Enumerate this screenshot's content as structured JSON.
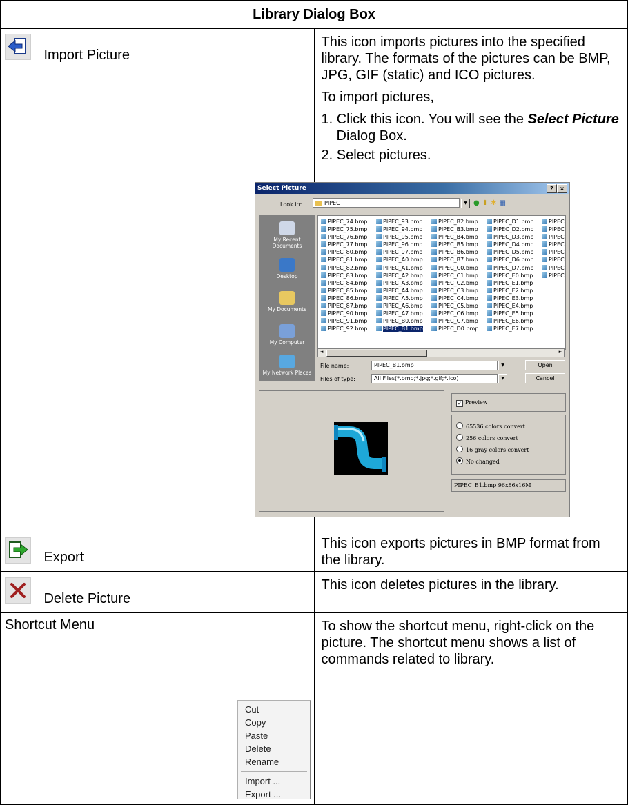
{
  "table": {
    "header": "Library Dialog Box",
    "rows": [
      {
        "label": "Import Picture",
        "icon": "import-icon",
        "desc1": "This icon imports pictures into the specified library. The formats of the pictures can be BMP, JPG, GIF (static) and ICO pictures.",
        "desc2": "To import pictures,",
        "step1_prefix": "1. Click this icon. You will see the ",
        "step1_em": "Select Picture",
        "step1_suffix": " Dialog Box.",
        "step2": "2. Select pictures."
      },
      {
        "label": "Export",
        "icon": "export-icon",
        "desc": "This icon exports pictures in BMP format from the library."
      },
      {
        "label": "Delete Picture",
        "icon": "delete-icon",
        "desc": "This icon deletes pictures in the library."
      },
      {
        "label": "Shortcut Menu",
        "desc": "To show the shortcut menu, right-click on the picture. The shortcut menu shows a list of commands related to library."
      }
    ]
  },
  "dialog": {
    "title": "Select Picture",
    "help_btn": "?",
    "close_btn": "×",
    "look_in_label": "Look in:",
    "look_in_value": "PIPEC",
    "places": [
      "My Recent Documents",
      "Desktop",
      "My Documents",
      "My Computer",
      "My Network Places"
    ],
    "file_columns": [
      [
        "PIPEC_74.bmp",
        "PIPEC_75.bmp",
        "PIPEC_76.bmp",
        "PIPEC_77.bmp",
        "PIPEC_80.bmp",
        "PIPEC_81.bmp",
        "PIPEC_82.bmp",
        "PIPEC_83.bmp",
        "PIPEC_84.bmp",
        "PIPEC_85.bmp",
        "PIPEC_86.bmp",
        "PIPEC_87.bmp",
        "PIPEC_90.bmp",
        "PIPEC_91.bmp",
        "PIPEC_92.bmp"
      ],
      [
        "PIPEC_93.bmp",
        "PIPEC_94.bmp",
        "PIPEC_95.bmp",
        "PIPEC_96.bmp",
        "PIPEC_97.bmp",
        "PIPEC_A0.bmp",
        "PIPEC_A1.bmp",
        "PIPEC_A2.bmp",
        "PIPEC_A3.bmp",
        "PIPEC_A4.bmp",
        "PIPEC_A5.bmp",
        "PIPEC_A6.bmp",
        "PIPEC_A7.bmp",
        "PIPEC_B0.bmp",
        "PIPEC_B1.bmp"
      ],
      [
        "PIPEC_B2.bmp",
        "PIPEC_B3.bmp",
        "PIPEC_B4.bmp",
        "PIPEC_B5.bmp",
        "PIPEC_B6.bmp",
        "PIPEC_B7.bmp",
        "PIPEC_C0.bmp",
        "PIPEC_C1.bmp",
        "PIPEC_C2.bmp",
        "PIPEC_C3.bmp",
        "PIPEC_C4.bmp",
        "PIPEC_C5.bmp",
        "PIPEC_C6.bmp",
        "PIPEC_C7.bmp",
        "PIPEC_D0.bmp"
      ],
      [
        "PIPEC_D1.bmp",
        "PIPEC_D2.bmp",
        "PIPEC_D3.bmp",
        "PIPEC_D4.bmp",
        "PIPEC_D5.bmp",
        "PIPEC_D6.bmp",
        "PIPEC_D7.bmp",
        "PIPEC_E0.bmp",
        "PIPEC_E1.bmp",
        "PIPEC_E2.bmp",
        "PIPEC_E3.bmp",
        "PIPEC_E4.bmp",
        "PIPEC_E5.bmp",
        "PIPEC_E6.bmp",
        "PIPEC_E7.bmp"
      ],
      [
        "PIPEC",
        "PIPEC",
        "PIPEC",
        "PIPEC",
        "PIPEC",
        "PIPEC",
        "PIPEC",
        "PIPEC"
      ]
    ],
    "selected_file": "PIPEC_B1.bmp",
    "file_name_label": "File name:",
    "file_name_value": "PIPEC_B1.bmp",
    "files_of_type_label": "Files of type:",
    "files_of_type_value": "All Files(*.bmp;*.jpg;*.gif;*.ico)",
    "open_btn": "Open",
    "cancel_btn": "Cancel",
    "preview_label": "Preview",
    "preview_checked": true,
    "radios": [
      "65536 colors convert",
      "256 colors convert",
      "16 gray colors convert",
      "No changed"
    ],
    "radio_selected": "No changed",
    "status": "PIPEC_B1.bmp 96x86x16M"
  },
  "shortcut_menu": {
    "items_a": [
      "Cut",
      "Copy",
      "Paste",
      "Delete",
      "Rename"
    ],
    "items_b": [
      "Import ...",
      "Export ..."
    ]
  }
}
